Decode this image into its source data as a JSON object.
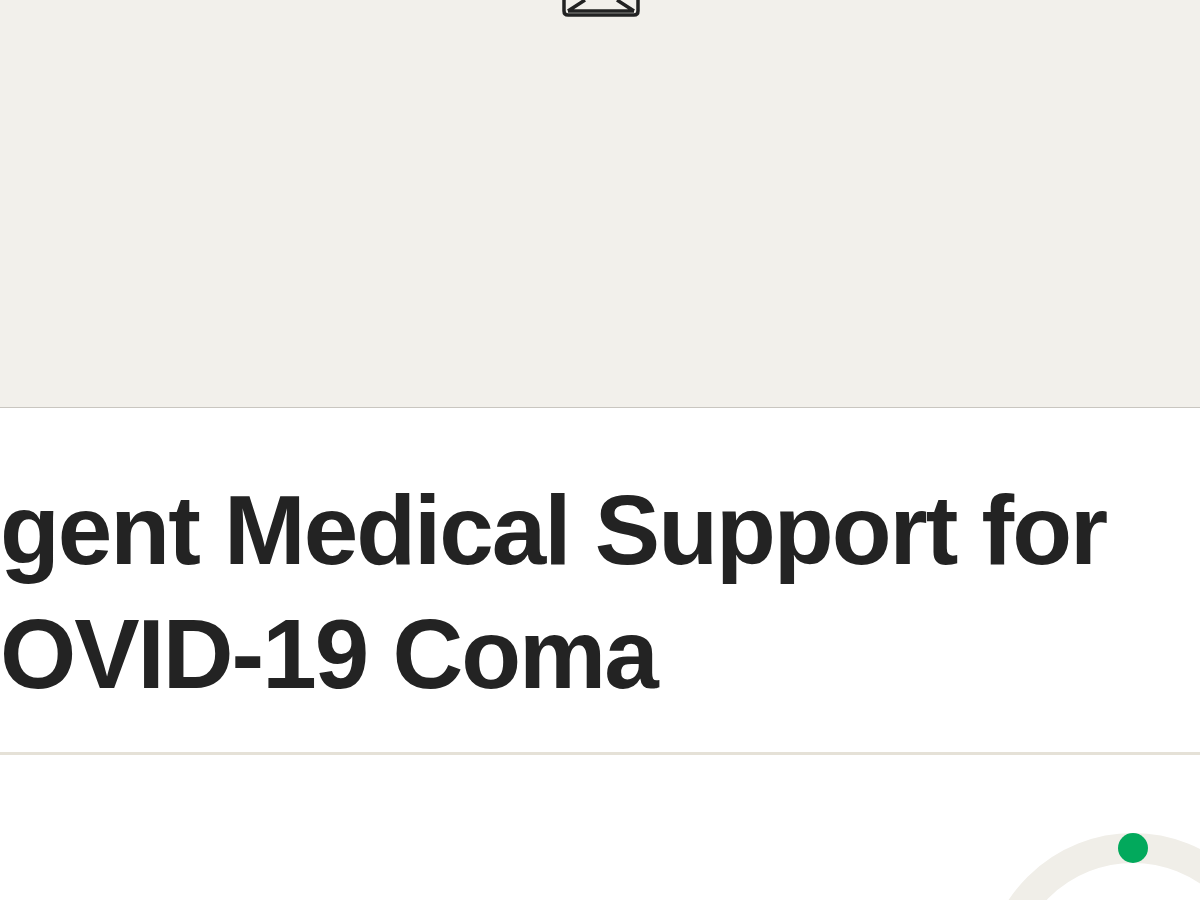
{
  "media": {
    "kind": "picture-placeholder"
  },
  "title": "gent Medical Support for OVID-19 Coma"
}
